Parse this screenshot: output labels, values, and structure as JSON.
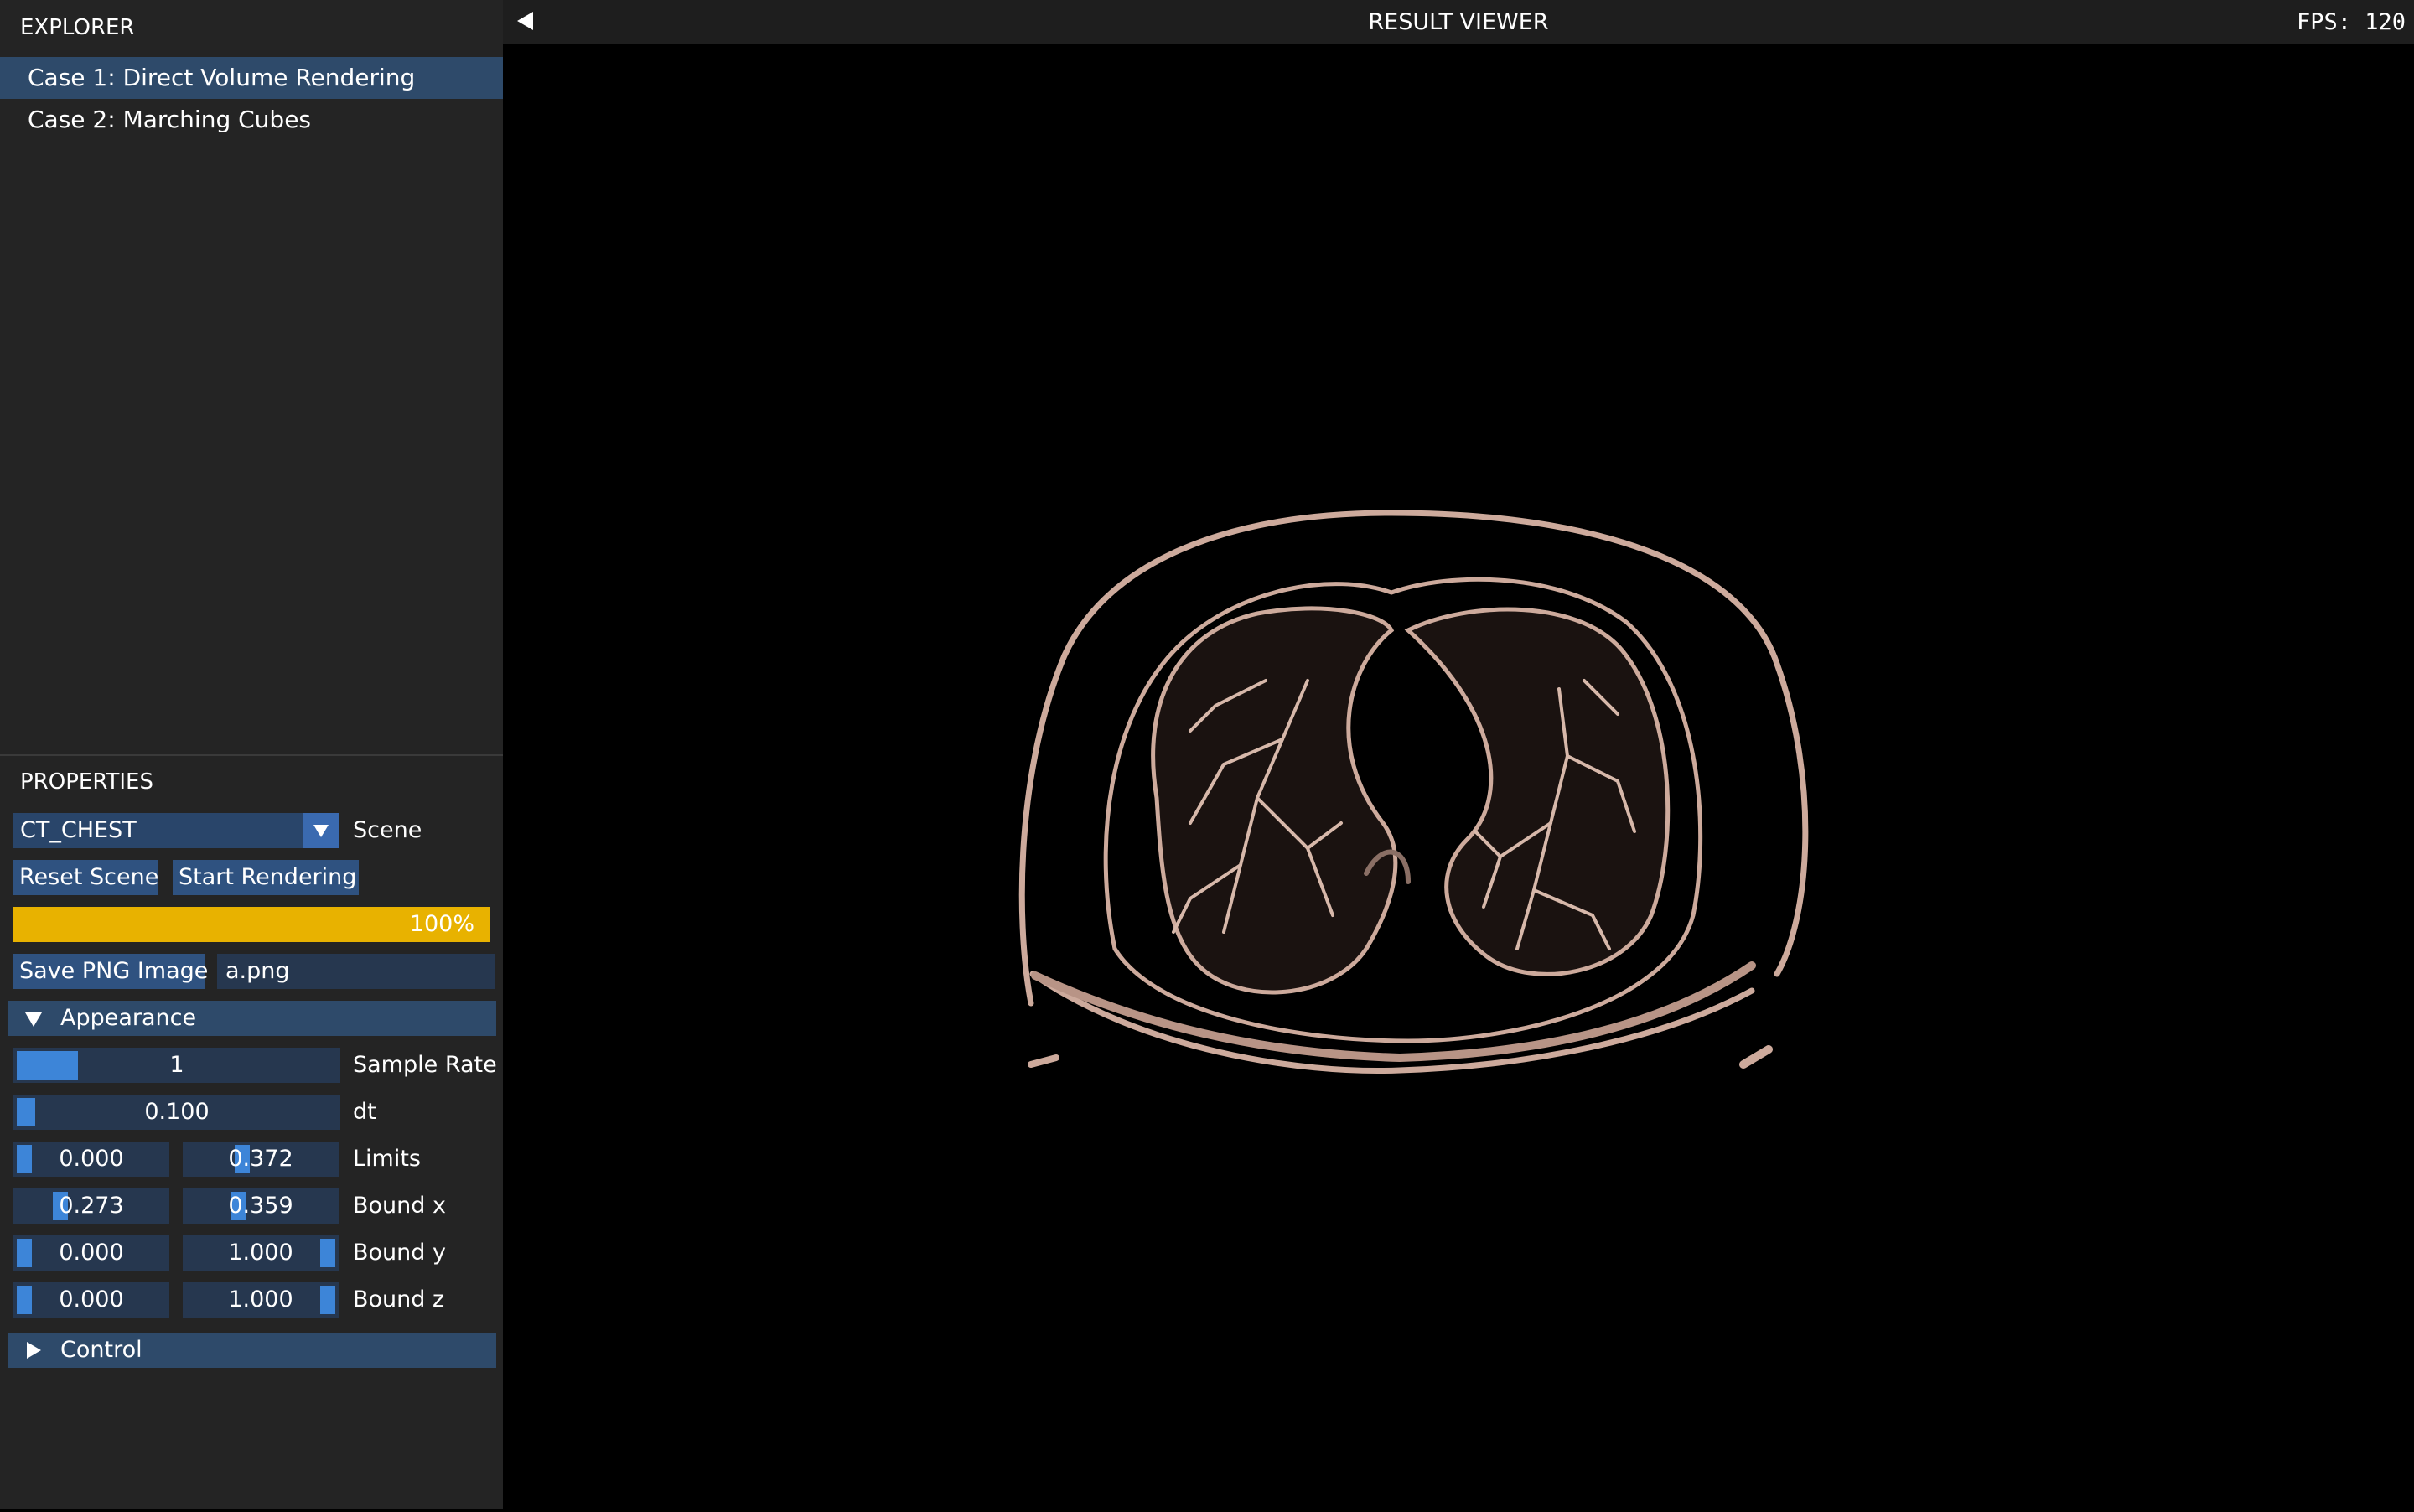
{
  "explorer": {
    "title": "EXPLORER",
    "cases": [
      {
        "label": "Case 1: Direct Volume Rendering",
        "selected": true
      },
      {
        "label": "Case 2: Marching Cubes",
        "selected": false
      }
    ]
  },
  "properties": {
    "title": "PROPERTIES",
    "scene": {
      "value": "CT_CHEST",
      "label": "Scene"
    },
    "reset_label": "Reset Scene",
    "start_label": "Start Rendering",
    "progress": {
      "value": 1.0,
      "text": "100%"
    },
    "save_label": "Save PNG Image",
    "filename": "a.png",
    "appearance": {
      "header": "Appearance",
      "expanded": true,
      "sample_rate": {
        "value": "1",
        "level": 0.2,
        "label": "Sample Rate"
      },
      "dt": {
        "value": "0.100",
        "level": 0.0,
        "label": "dt"
      },
      "limits": {
        "min": "0.000",
        "max": "0.372",
        "min_level": 0.0,
        "max_level": 0.372,
        "label": "Limits"
      },
      "bound_x": {
        "min": "0.273",
        "max": "0.359",
        "min_level": 0.273,
        "max_level": 0.359,
        "label": "Bound x"
      },
      "bound_y": {
        "min": "0.000",
        "max": "1.000",
        "min_level": 0.0,
        "max_level": 1.0,
        "label": "Bound y"
      },
      "bound_z": {
        "min": "0.000",
        "max": "1.000",
        "min_level": 0.0,
        "max_level": 1.0,
        "label": "Bound z"
      }
    },
    "control": {
      "header": "Control",
      "expanded": false
    }
  },
  "viewer": {
    "title": "RESULT VIEWER",
    "fps": "FPS: 120"
  },
  "colors": {
    "panel_bg": "#242424",
    "selected_bg": "#2e4a6a",
    "button_bg": "#2f5280",
    "progress": "#e8b200",
    "slider_bg": "#26374f",
    "slider_grab": "#3d85d8",
    "render": "#cdaa9c"
  },
  "icons": [
    "chevron-down-icon",
    "triangle-down-icon",
    "triangle-right-icon",
    "back-arrow-icon"
  ]
}
